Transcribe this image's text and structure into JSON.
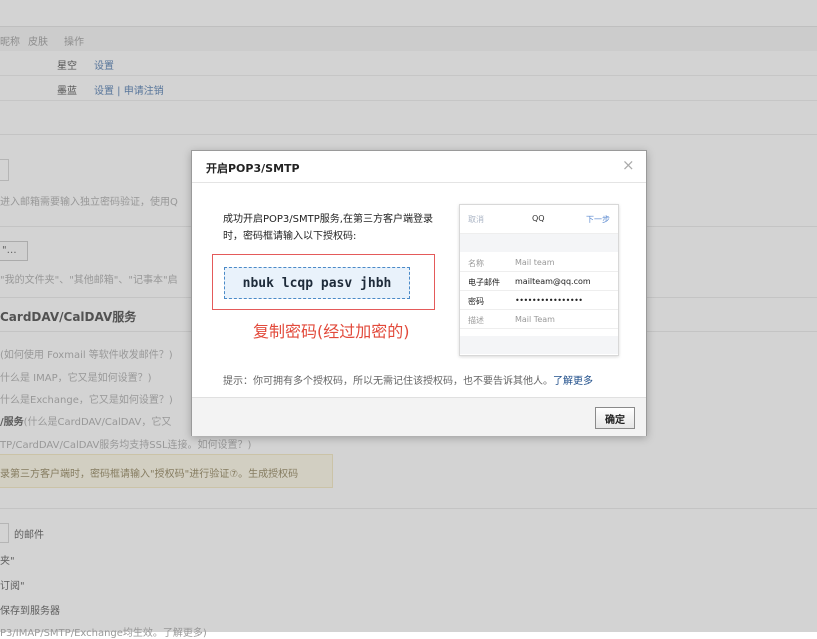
{
  "background": {
    "table_header": [
      "昵称",
      "皮肤",
      "操作"
    ],
    "rows": [
      {
        "name": "星空",
        "actions": "设置"
      },
      {
        "name": "墨蓝",
        "actions": "设置 | 申请注销"
      }
    ],
    "line1": "进入邮箱需要输入独立密码验证，使用Q",
    "btn_frag": "\"…",
    "line2": "\"我的文件夹\"、\"其他邮箱\"、\"记事本\"启",
    "section_title": "CardDAV/CalDAV服务",
    "svc1": "(如何使用 Foxmail 等软件收发邮件？)",
    "svc2": "什么是 IMAP，它又是如何设置？)",
    "svc3": "什么是Exchange，它又是如何设置？)",
    "svc4_bold": "/服务",
    "svc4_rest": "(什么是CardDAV/CalDAV，它又",
    "svc5": "TP/CardDAV/CalDAV服务均支持SSL连接。如何设置？)",
    "warning": "录第三方客户端时，密码框请输入\"授权码\"进行验证⑦。生成授权码",
    "opt1": "的邮件",
    "opt2": "夹\"",
    "opt3": "订阅\"",
    "opt4": "保存到服务器",
    "opt5": "P3/IMAP/SMTP/Exchange均生效。了解更多)"
  },
  "dialog": {
    "title": "开启POP3/SMTP",
    "close": "×",
    "message": "成功开启POP3/SMTP服务,在第三方客户端登录时，密码框请输入以下授权码:",
    "auth_code": "nbuk lcqp pasv jhbh",
    "copy_hint": "复制密码(经过加密的)",
    "tip": "提示：你可拥有多个授权码，所以无需记住该授权码，也不要告诉其他人。",
    "learn_more": "了解更多",
    "ok_button": "确定",
    "phone": {
      "cancel": "取消",
      "title": "QQ",
      "next": "下一步",
      "fields": [
        {
          "label": "名称",
          "value": "Mail team"
        },
        {
          "label": "电子邮件",
          "value": "mailteam@qq.com"
        },
        {
          "label": "密码",
          "value": "••••••••••••••••"
        },
        {
          "label": "描述",
          "value": "Mail Team"
        }
      ]
    }
  },
  "colors": {
    "accent_red": "#e24a3b",
    "link_blue": "#1f4e8a",
    "code_border": "#4a8ac8"
  }
}
